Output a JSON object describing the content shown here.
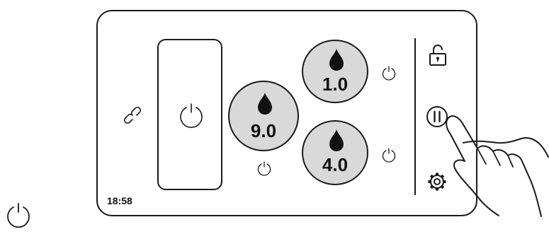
{
  "status": {
    "clock": "18:58"
  },
  "burners": [
    {
      "id": "burner-left",
      "level": "9.0"
    },
    {
      "id": "burner-top-right",
      "level": "1.0"
    },
    {
      "id": "burner-bottom-right",
      "level": "4.0"
    }
  ],
  "icons": {
    "main_power": "power-icon",
    "link": "link-icon",
    "zone_power": "power-icon",
    "lock": "unlock-icon",
    "pause": "pause-icon",
    "settings": "gear-icon",
    "pointer": "hand-pointer"
  },
  "colors": {
    "burner_fill": "#d9d9d9",
    "stroke": "#1a1a1a",
    "background": "#ffffff"
  }
}
